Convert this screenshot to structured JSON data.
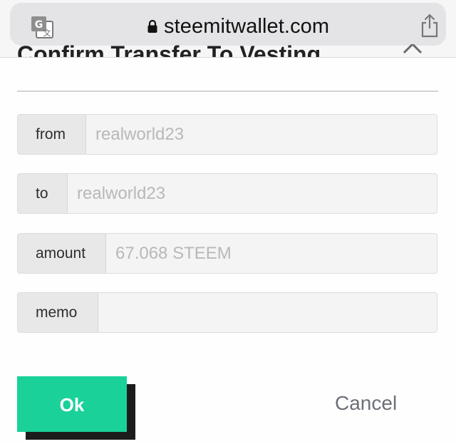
{
  "browser": {
    "domain": "steemitwallet.com",
    "icons": {
      "translate": "translate-icon",
      "lock": "lock-icon",
      "share": "share-icon"
    }
  },
  "dialog": {
    "title": "Confirm Transfer To Vesting",
    "close_icon": "close-icon",
    "fields": [
      {
        "label": "from",
        "value": "realworld23"
      },
      {
        "label": "to",
        "value": "realworld23"
      },
      {
        "label": "amount",
        "value": "67.068 STEEM"
      },
      {
        "label": "memo",
        "value": ""
      }
    ],
    "ok_label": "Ok",
    "cancel_label": "Cancel"
  },
  "colors": {
    "ok_button": "#1ad19a",
    "ok_shadow": "#1c1c1c",
    "cancel_text": "#6b7077"
  }
}
